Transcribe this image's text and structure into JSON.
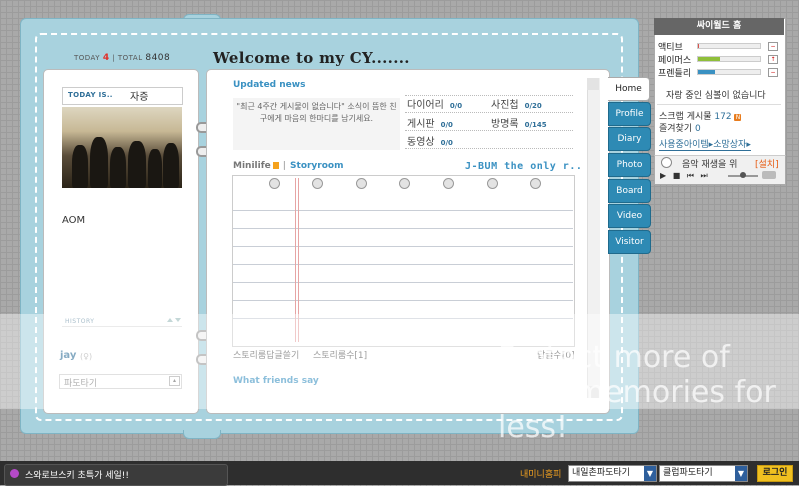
{
  "counter": {
    "today_label": "TODAY",
    "today_value": "4",
    "total_label": "TOTAL",
    "total_value": "8408"
  },
  "title": "Welcome to my CY.......",
  "profile": {
    "today_is_label": "TODAY IS..",
    "today_mood": "자증",
    "intro": "AOM",
    "history_label": "HISTORY",
    "owner_name": "jay",
    "owner_extra": "(♀)",
    "surf_label": "파도타기"
  },
  "updated_news": {
    "title": "Updated news",
    "empty_message": "\"최근 4주간 게시물이 없습니다\" 소식이 뜸한 친구에게 마음의 한마디를 남기세요.",
    "menus": [
      {
        "label": "다이어리",
        "count": "0/0"
      },
      {
        "label": "사진첩",
        "count": "0/20"
      },
      {
        "label": "게시판",
        "count": "0/0"
      },
      {
        "label": "방명록",
        "count": "0/145"
      },
      {
        "label": "동영상",
        "count": "0/0"
      }
    ]
  },
  "minilife": {
    "tab1": "Minilife",
    "sep": "|",
    "tab2": "Storyroom",
    "subtitle": "J-BUM the only r..",
    "footer_left": "스토리룸답글쓸기",
    "footer_mid": "스토리룸수[1]",
    "footer_right": "답글수[0]"
  },
  "friends": {
    "title": "What friends say"
  },
  "tabs": [
    "Home",
    "Profile",
    "Diary",
    "Photo",
    "Board",
    "Video",
    "Visitor"
  ],
  "right_panel": {
    "header": "싸이월드 홈",
    "stats": [
      {
        "label": "액티브",
        "level": 0.02,
        "color": "#d9534f"
      },
      {
        "label": "페이머스",
        "level": 0.35,
        "color": "#8fbf3a"
      },
      {
        "label": "프렌들리",
        "level": 0.28,
        "color": "#3a91c2"
      }
    ],
    "friends_status": "자랑 중인 심볼이 없습니다",
    "scrap_label": "스크랩 게시물",
    "scrap_count": "172",
    "scrap_badge": "N",
    "fav_label": "즐겨찾기",
    "fav_count": "0",
    "items_link": "사용중아이템▸소망상자▸",
    "music_label": "음악 재생을 위",
    "music_setup": "[설치]",
    "music_controls": "▶ ■ ⏮ ⏭"
  },
  "watermark": {
    "text": "Protect more of your memories for less!"
  },
  "bottom_bar": {
    "ad_text": "스와로브스키 초특가 세일!!",
    "mini_home": "내미니홈피",
    "select1": "내일촌파도타기",
    "select2": "클럽파도타기",
    "login": "로그인"
  }
}
